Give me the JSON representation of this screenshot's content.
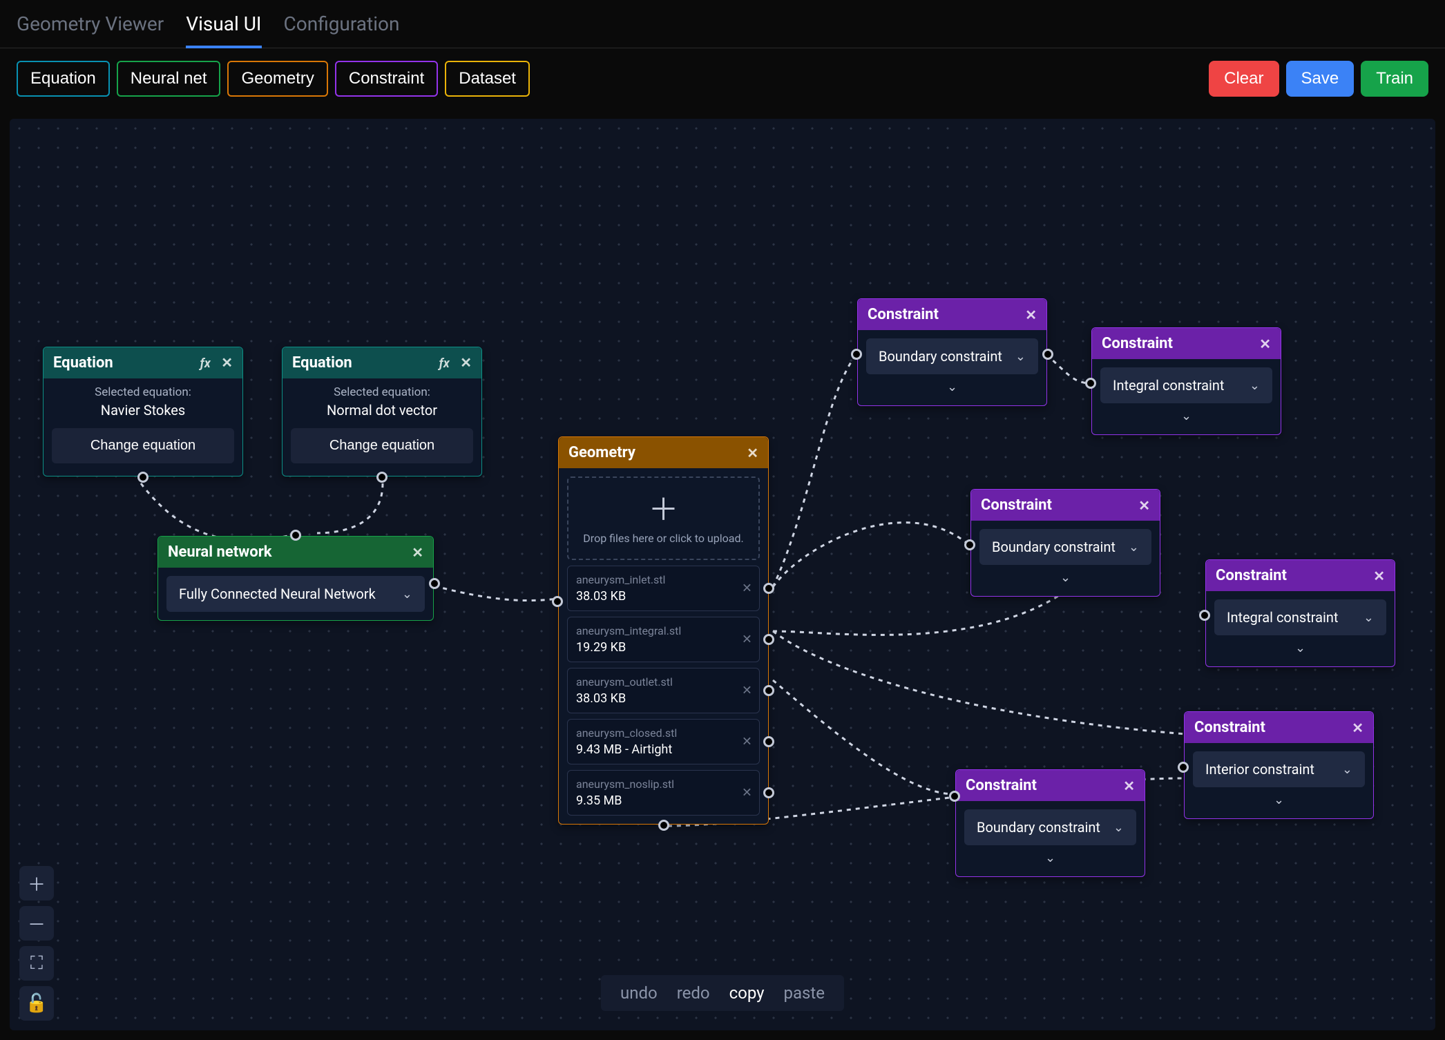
{
  "tabs": [
    "Geometry Viewer",
    "Visual UI",
    "Configuration"
  ],
  "active_tab": 1,
  "toolbar": {
    "chips": {
      "equation": "Equation",
      "neuralnet": "Neural net",
      "geometry": "Geometry",
      "constraint": "Constraint",
      "dataset": "Dataset"
    },
    "clear": "Clear",
    "save": "Save",
    "train": "Train"
  },
  "bottom": {
    "undo": "undo",
    "redo": "redo",
    "copy": "copy",
    "paste": "paste"
  },
  "nodes": {
    "eq1": {
      "title": "Equation",
      "selected_label": "Selected equation:",
      "selected": "Navier Stokes",
      "change": "Change equation"
    },
    "eq2": {
      "title": "Equation",
      "selected_label": "Selected equation:",
      "selected": "Normal dot vector",
      "change": "Change equation"
    },
    "nn": {
      "title": "Neural network",
      "select": "Fully Connected Neural Network"
    },
    "geom": {
      "title": "Geometry",
      "dropzone": "Drop files here or click to upload.",
      "files": [
        {
          "name": "aneurysm_inlet.stl",
          "size": "38.03 KB"
        },
        {
          "name": "aneurysm_integral.stl",
          "size": "19.29 KB"
        },
        {
          "name": "aneurysm_outlet.stl",
          "size": "38.03 KB"
        },
        {
          "name": "aneurysm_closed.stl",
          "size": "9.43 MB - Airtight"
        },
        {
          "name": "aneurysm_noslip.stl",
          "size": "9.35 MB"
        }
      ]
    },
    "constraints": [
      {
        "title": "Constraint",
        "type": "Boundary constraint"
      },
      {
        "title": "Constraint",
        "type": "Integral constraint"
      },
      {
        "title": "Constraint",
        "type": "Boundary constraint"
      },
      {
        "title": "Constraint",
        "type": "Integral constraint"
      },
      {
        "title": "Constraint",
        "type": "Boundary constraint"
      },
      {
        "title": "Constraint",
        "type": "Interior constraint"
      }
    ]
  }
}
